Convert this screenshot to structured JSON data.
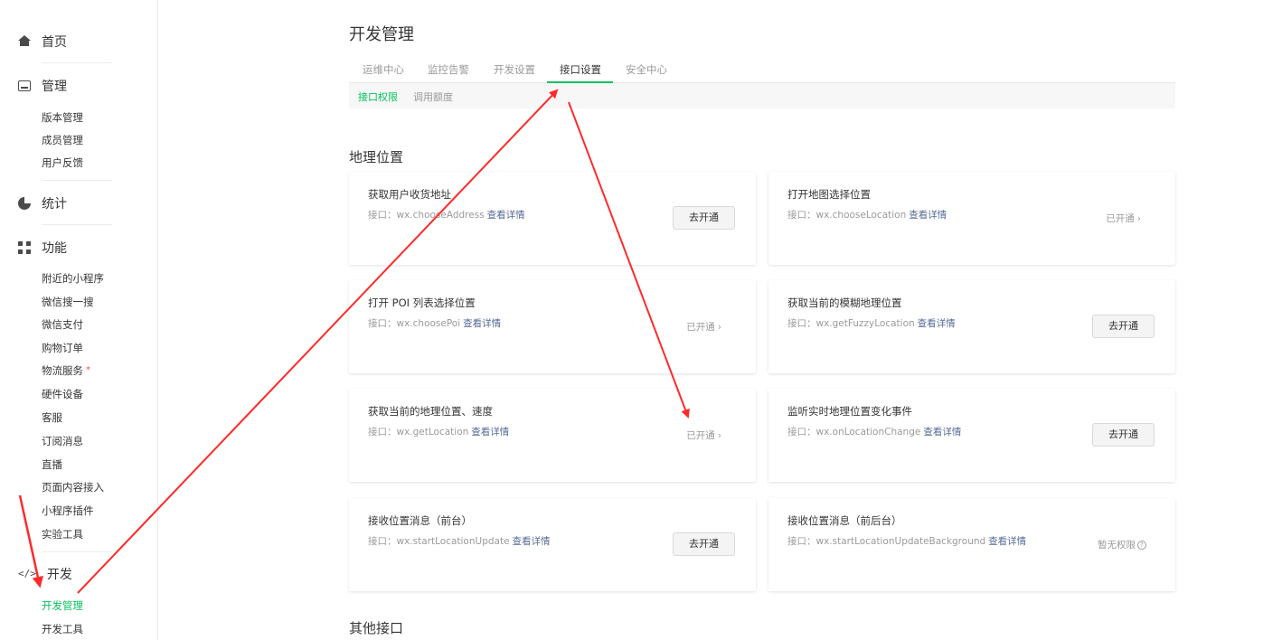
{
  "sidebar": {
    "groups": [
      {
        "label": "首页",
        "icon": "home-icon"
      },
      {
        "label": "管理",
        "icon": "inbox-icon"
      },
      {
        "label": "统计",
        "icon": "pie-chart-icon"
      },
      {
        "label": "功能",
        "icon": "grid-icon"
      },
      {
        "label": "开发",
        "icon": "code-icon",
        "icon_glyph": "</>"
      }
    ],
    "manage_items": [
      "版本管理",
      "成员管理",
      "用户反馈"
    ],
    "feature_items": [
      "附近的小程序",
      "微信搜一搜",
      "微信支付",
      "购物订单",
      "物流服务",
      "硬件设备",
      "客服",
      "订阅消息",
      "直播",
      "页面内容接入",
      "小程序插件",
      "实验工具"
    ],
    "feature_badge": "*",
    "dev_items": [
      "开发管理",
      "开发工具"
    ]
  },
  "main": {
    "title": "开发管理",
    "tabs": [
      "运维中心",
      "监控告警",
      "开发设置",
      "接口设置",
      "安全中心"
    ],
    "active_tab": "接口设置",
    "subtabs": [
      "接口权限",
      "调用额度"
    ],
    "active_subtab": "接口权限",
    "sections": [
      {
        "title": "地理位置",
        "cards": [
          {
            "title": "获取用户收货地址",
            "prefix": "接口：",
            "api": "wx.chooseAddress",
            "link": "查看详情",
            "action_type": "button",
            "action": "去开通"
          },
          {
            "title": "打开地图选择位置",
            "prefix": "接口：",
            "api": "wx.chooseLocation",
            "link": "查看详情",
            "action_type": "status",
            "action": "已开通",
            "suffix": "›"
          },
          {
            "title": "打开 POI 列表选择位置",
            "prefix": "接口：",
            "api": "wx.choosePoi",
            "link": "查看详情",
            "action_type": "status",
            "action": "已开通",
            "suffix": "›"
          },
          {
            "title": "获取当前的模糊地理位置",
            "prefix": "接口：",
            "api": "wx.getFuzzyLocation",
            "link": "查看详情",
            "action_type": "button",
            "action": "去开通"
          },
          {
            "title": "获取当前的地理位置、速度",
            "prefix": "接口：",
            "api": "wx.getLocation",
            "link": "查看详情",
            "action_type": "status",
            "action": "已开通",
            "suffix": "›"
          },
          {
            "title": "监听实时地理位置变化事件",
            "prefix": "接口：",
            "api": "wx.onLocationChange",
            "link": "查看详情",
            "action_type": "button",
            "action": "去开通"
          },
          {
            "title": "接收位置消息（前台）",
            "prefix": "接口：",
            "api": "wx.startLocationUpdate",
            "link": "查看详情",
            "action_type": "button",
            "action": "去开通"
          },
          {
            "title": "接收位置消息（前后台）",
            "prefix": "接口：",
            "api": "wx.startLocationUpdateBackground",
            "link": "查看详情",
            "action_type": "status",
            "action": "暂无权限",
            "suffix": "?"
          }
        ]
      },
      {
        "title": "其他接口"
      }
    ]
  },
  "colors": {
    "accent": "#07c160",
    "link": "#576b95",
    "annotation_arrow": "#ff2a2a"
  }
}
